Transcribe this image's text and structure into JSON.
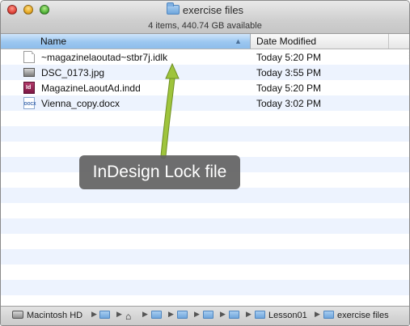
{
  "window": {
    "title": "exercise files",
    "info": "4 items, 440.74 GB available"
  },
  "columns": {
    "name_label": "Name",
    "date_label": "Date Modified"
  },
  "files": [
    {
      "name": "~magazinelaoutad~stbr7j.idlk",
      "date": "Today 5:20 PM",
      "icon": "lock-file-icon"
    },
    {
      "name": "DSC_0173.jpg",
      "date": "Today 3:55 PM",
      "icon": "image-file-icon"
    },
    {
      "name": "MagazineLaoutAd.indd",
      "date": "Today 5:20 PM",
      "icon": "indesign-file-icon"
    },
    {
      "name": "Vienna_copy.docx",
      "date": "Today 3:02 PM",
      "icon": "docx-file-icon"
    }
  ],
  "icon_labels": {
    "indd": "Id",
    "docx": "DOCX"
  },
  "annotation": {
    "text": "InDesign Lock file",
    "arrow_color": "#9ec43c"
  },
  "pathbar": {
    "drive": "Macintosh HD",
    "items": [
      "Lesson01",
      "exercise files"
    ]
  }
}
